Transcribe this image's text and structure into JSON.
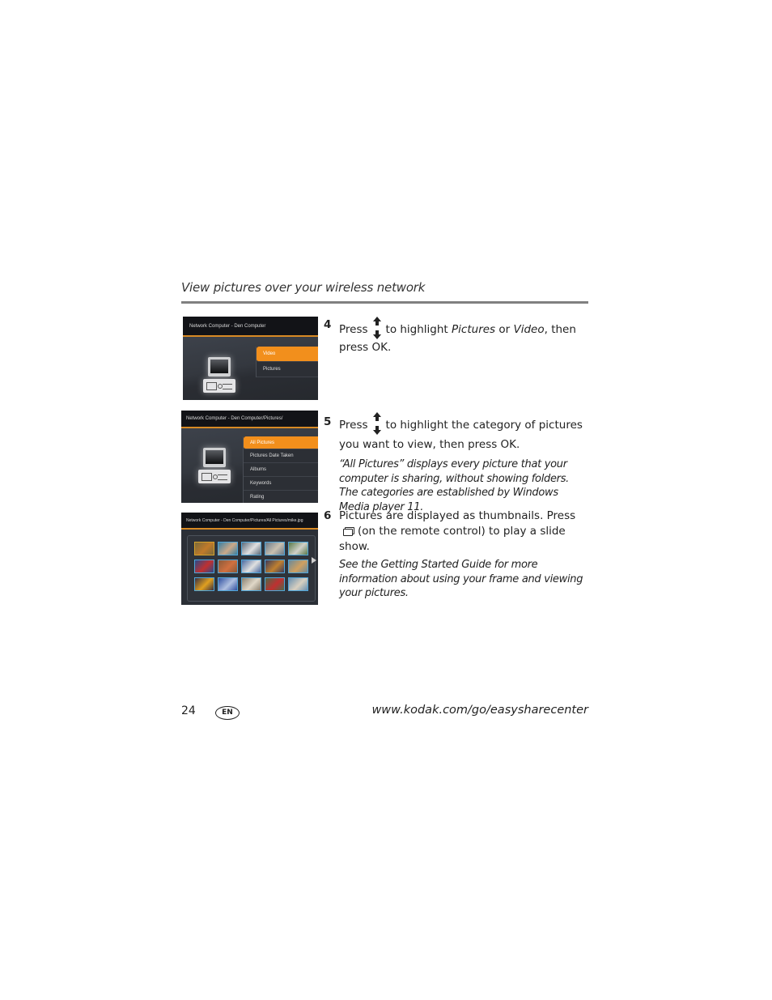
{
  "header": {
    "section_title": "View pictures over your wireless network"
  },
  "screens": {
    "screen1": {
      "title": "Network Computer - Den Computer",
      "menu": [
        {
          "label": "Video",
          "active": true
        },
        {
          "label": "Pictures",
          "active": false
        }
      ]
    },
    "screen2": {
      "title": "Network Computer - Den Computer/Pictures/",
      "menu": [
        {
          "label": "All Pictures",
          "active": true
        },
        {
          "label": "Pictures Date Taken",
          "active": false
        },
        {
          "label": "Albums",
          "active": false
        },
        {
          "label": "Keywords",
          "active": false
        },
        {
          "label": "Rating",
          "active": false
        }
      ]
    },
    "screen3": {
      "title": "Network Computer - Den Computer/Pictures/All Pictures/mike.jpg",
      "thumbnail_count": 15,
      "selected_index": 0
    }
  },
  "steps": [
    {
      "number": "4",
      "press": "Press",
      "text_a": "to highlight ",
      "em1": "Pictures",
      "text_b": " or ",
      "em2": "Video",
      "text_c": ", then press OK.",
      "icon": "up-down-arrow-icon"
    },
    {
      "number": "5",
      "press": "Press",
      "text": "to highlight the category of pictures you want to view, then press OK.",
      "note": "“All Pictures” displays every picture that your computer is sharing, without showing folders. The categories are established by Windows Media player 11.",
      "icon": "up-down-arrow-icon"
    },
    {
      "number": "6",
      "text_a": "Pictures are displayed as thumbnails. Press",
      "text_b": "(on the remote control) to play a slide show.",
      "note": "See the Getting Started Guide for more information about using your frame and viewing your pictures.",
      "icon": "slideshow-icon"
    }
  ],
  "footer": {
    "page_number": "24",
    "language_badge": "EN",
    "url": "www.kodak.com/go/easysharecenter"
  },
  "colors": {
    "accent_orange": "#f28f1c",
    "rule_gray": "#808080",
    "thumb_border": "#4fa6d9",
    "thumb_selected": "#d6a22b"
  }
}
